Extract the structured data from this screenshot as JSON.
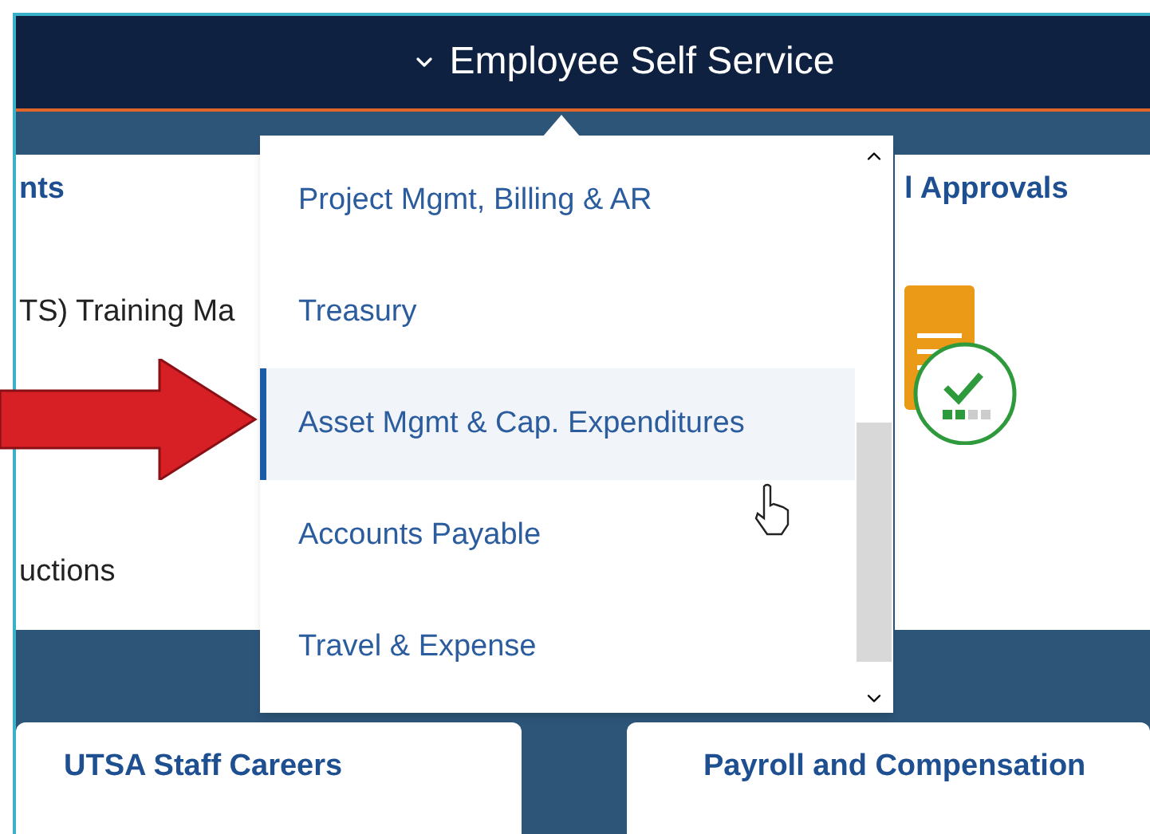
{
  "header": {
    "title": "Employee Self Service"
  },
  "top_tiles": [
    {
      "title": "nts",
      "lines": [
        "TS) Training Ma",
        "uctions"
      ]
    },
    {
      "title": "l Approvals"
    }
  ],
  "menu": {
    "items": [
      {
        "label": "Project Mgmt, Billing & AR",
        "selected": false
      },
      {
        "label": "Treasury",
        "selected": false
      },
      {
        "label": "Asset Mgmt & Cap. Expenditures",
        "selected": true
      },
      {
        "label": "Accounts Payable",
        "selected": false
      },
      {
        "label": "Travel & Expense",
        "selected": false
      }
    ]
  },
  "bottom_tiles": [
    {
      "title": "UTSA Staff Careers"
    },
    {
      "title": "Payroll and Compensation"
    }
  ]
}
